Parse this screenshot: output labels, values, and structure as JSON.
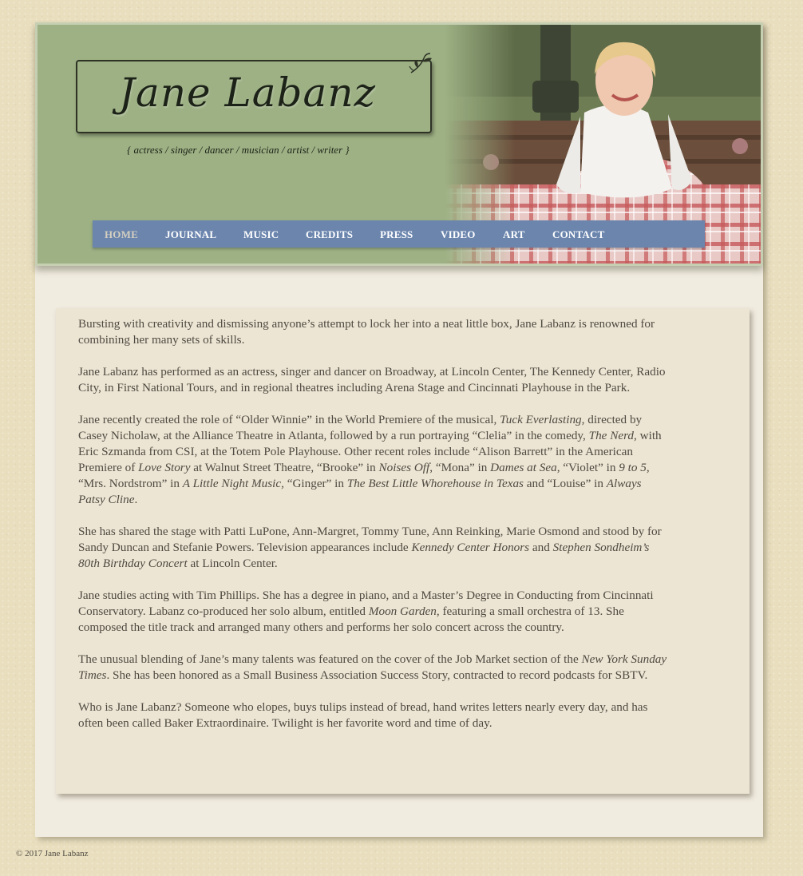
{
  "site": {
    "name": "Jane Labanz",
    "tagline": "{ actress / singer / dancer / musician / artist / writer }"
  },
  "nav": {
    "items": [
      {
        "label": "HOME",
        "active": true
      },
      {
        "label": "JOURNAL",
        "active": false
      },
      {
        "label": "MUSIC",
        "active": false
      },
      {
        "label": "CREDITS",
        "active": false
      },
      {
        "label": "PRESS",
        "active": false
      },
      {
        "label": "VIDEO",
        "active": false
      },
      {
        "label": "ART",
        "active": false
      },
      {
        "label": "CONTACT",
        "active": false
      }
    ]
  },
  "content": {
    "paragraphs": [
      [
        {
          "t": "Bursting with creativity and dismissing anyone’s attempt to lock her into a neat little box, Jane Labanz is renowned for combining her many sets of skills."
        }
      ],
      [
        {
          "t": "Jane Labanz has performed as an actress, singer and dancer on Broadway, at Lincoln Center, The Kennedy Center, Radio City, in First National Tours, and in regional theatres including Arena Stage and Cincinnati Playhouse in the Park."
        }
      ],
      [
        {
          "t": "Jane recently created the role of “Older Winnie” in the World Premiere of the musical, "
        },
        {
          "t": "Tuck Everlasting",
          "i": true
        },
        {
          "t": ", directed by Casey Nicholaw, at the Alliance Theatre in Atlanta, followed by a run portraying “Clelia” in the comedy, "
        },
        {
          "t": "The Nerd",
          "i": true
        },
        {
          "t": ", with Eric Szmanda from CSI, at the Totem Pole Playhouse. Other recent roles include  “Alison Barrett” in the American Premiere of "
        },
        {
          "t": "Love Story",
          "i": true
        },
        {
          "t": " at Walnut Street Theatre, “Brooke” in "
        },
        {
          "t": "Noises Off",
          "i": true
        },
        {
          "t": ", “Mona” in "
        },
        {
          "t": "Dames at Sea",
          "i": true
        },
        {
          "t": ", “Violet” in "
        },
        {
          "t": "9 to 5",
          "i": true
        },
        {
          "t": ", “Mrs. Nordstrom” in "
        },
        {
          "t": "A Little Night Music,",
          "i": true
        },
        {
          "t": " “Ginger” in "
        },
        {
          "t": "The Best Little Whorehouse in Texas",
          "i": true
        },
        {
          "t": " and “Louise” in "
        },
        {
          "t": "Always Patsy Cline",
          "i": true
        },
        {
          "t": "."
        }
      ],
      [
        {
          "t": "She has shared the stage with Patti LuPone, Ann-Margret, Tommy Tune, Ann Reinking, Marie Osmond and stood by for Sandy Duncan and Stefanie Powers.  Television appearances include "
        },
        {
          "t": "Kennedy Center Honors",
          "i": true
        },
        {
          "t": " and "
        },
        {
          "t": "Stephen Sondheim’s 80th Birthday Concert",
          "i": true
        },
        {
          "t": " at Lincoln Center."
        }
      ],
      [
        {
          "t": "Jane studies acting with Tim Phillips. She has a degree in piano, and a Master’s Degree in Conducting from Cincinnati Conservatory. Labanz co-produced her solo album, entitled "
        },
        {
          "t": "Moon Garden",
          "i": true
        },
        {
          "t": ", featuring a small orchestra of 13. She composed the title track and arranged many others and performs her solo concert across the country."
        }
      ],
      [
        {
          "t": "The unusual blending of Jane’s many talents was featured on the cover of the Job Market section of the "
        },
        {
          "t": "New York Sunday Times",
          "i": true
        },
        {
          "t": ".  She has been honored as a Small Business Association Success Story, contracted to record podcasts for SBTV."
        }
      ],
      [
        {
          "t": "Who is Jane Labanz? Someone who elopes, buys tulips instead of bread, hand writes letters nearly every day, and has often been called Baker Extraordinaire. Twilight is her favorite word and time of day."
        }
      ]
    ]
  },
  "footer": {
    "copyright": "© 2017 Jane Labanz"
  },
  "colors": {
    "header_green": "#9db184",
    "nav_blue": "#6b85ad",
    "card_bg": "#ece5d4",
    "body_text": "#4f4a41",
    "page_bg": "#e9dfbf"
  },
  "icons": {
    "logo_flourish": "leaf-flourish-icon",
    "header_photo": "portrait-photo"
  }
}
